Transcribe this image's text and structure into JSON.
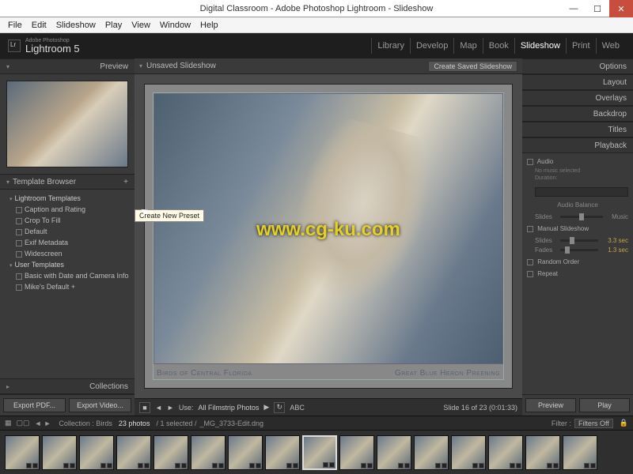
{
  "titlebar": {
    "title": "Digital Classroom - Adobe Photoshop Lightroom - Slideshow"
  },
  "menubar": [
    "File",
    "Edit",
    "Slideshow",
    "Play",
    "View",
    "Window",
    "Help"
  ],
  "identity": {
    "vendor": "Adobe Photoshop",
    "product": "Lightroom 5"
  },
  "modules": [
    "Library",
    "Develop",
    "Map",
    "Book",
    "Slideshow",
    "Print",
    "Web"
  ],
  "active_module": "Slideshow",
  "left": {
    "preview_header": "Preview",
    "template_header": "Template Browser",
    "collections_header": "Collections",
    "lightroom_group": "Lightroom Templates",
    "lightroom_templates": [
      "Caption and Rating",
      "Crop To Fill",
      "Default",
      "Exif Metadata",
      "Widescreen"
    ],
    "user_group": "User Templates",
    "user_templates": [
      "Basic with Date and Camera Info",
      "Mike's Default +"
    ],
    "export_pdf": "Export PDF...",
    "export_video": "Export Video..."
  },
  "tooltip_text": "Create New Preset",
  "center": {
    "unsaved": "Unsaved Slideshow",
    "create_saved": "Create Saved Slideshow",
    "caption_left": "Birds of Central Florida",
    "caption_right": "Great Blue Heron Preening",
    "use_label": "Use:",
    "use_value": "All Filmstrip Photos",
    "abc_label": "ABC",
    "slide_counter": "Slide 16 of 23 (0:01:33)"
  },
  "right": {
    "sections": [
      "Options",
      "Layout",
      "Overlays",
      "Backdrop",
      "Titles",
      "Playback"
    ],
    "audio_label": "Audio",
    "audio_none": "No music selected",
    "duration_label": "Duration:",
    "balance_label": "Audio Balance",
    "balance_left": "Slides",
    "balance_right": "Music",
    "manual_label": "Manual Slideshow",
    "slides_label": "Slides",
    "slides_value": "3.3 sec",
    "fades_label": "Fades",
    "fades_value": "1.3 sec",
    "random_label": "Random Order",
    "repeat_label": "Repeat",
    "preview_btn": "Preview",
    "play_btn": "Play"
  },
  "filmstrip": {
    "collection_label": "Collection : Birds",
    "count": "23 photos",
    "selection": "/ 1 selected /",
    "filename": "_MG_3733-Edit.dng",
    "filter_label": "Filter :",
    "filter_value": "Filters Off",
    "thumb_count": 16,
    "selected_index": 8
  },
  "watermark": "www.cg-ku.com"
}
